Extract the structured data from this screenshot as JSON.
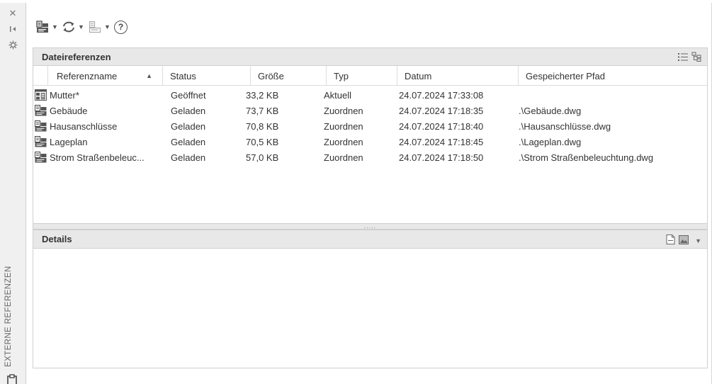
{
  "palette": {
    "title": "EXTERNE REFERENZEN"
  },
  "sections": {
    "file_references": "Dateireferenzen",
    "details": "Details"
  },
  "columns": [
    "Referenzname",
    "Status",
    "Größe",
    "Typ",
    "Datum",
    "Gespeicherter Pfad"
  ],
  "sort": {
    "column": "Referenzname",
    "direction": "ascending"
  },
  "references": [
    {
      "name": "Mutter*",
      "status": "Geöffnet",
      "size": "33,2 KB",
      "type": "Aktuell",
      "date": "24.07.2024 17:33:08",
      "path": "",
      "icon": "drawing-master-icon"
    },
    {
      "name": "Gebäude",
      "status": "Geladen",
      "size": "73,7 KB",
      "type": "Zuordnen",
      "date": "24.07.2024 17:18:35",
      "path": ".\\Gebäude.dwg",
      "icon": "xref-attach-icon"
    },
    {
      "name": "Hausanschlüsse",
      "status": "Geladen",
      "size": "70,8 KB",
      "type": "Zuordnen",
      "date": "24.07.2024 17:18:40",
      "path": ".\\Hausanschlüsse.dwg",
      "icon": "xref-attach-icon"
    },
    {
      "name": "Lageplan",
      "status": "Geladen",
      "size": "70,5 KB",
      "type": "Zuordnen",
      "date": "24.07.2024 17:18:45",
      "path": ".\\Lageplan.dwg",
      "icon": "xref-attach-icon"
    },
    {
      "name": "Strom Straßenbeleuc...",
      "status": "Geladen",
      "size": "57,0 KB",
      "type": "Zuordnen",
      "date": "24.07.2024 17:18:50",
      "path": ".\\Strom Straßenbeleuchtung.dwg",
      "icon": "xref-attach-icon"
    }
  ],
  "splitter_grip": "....."
}
